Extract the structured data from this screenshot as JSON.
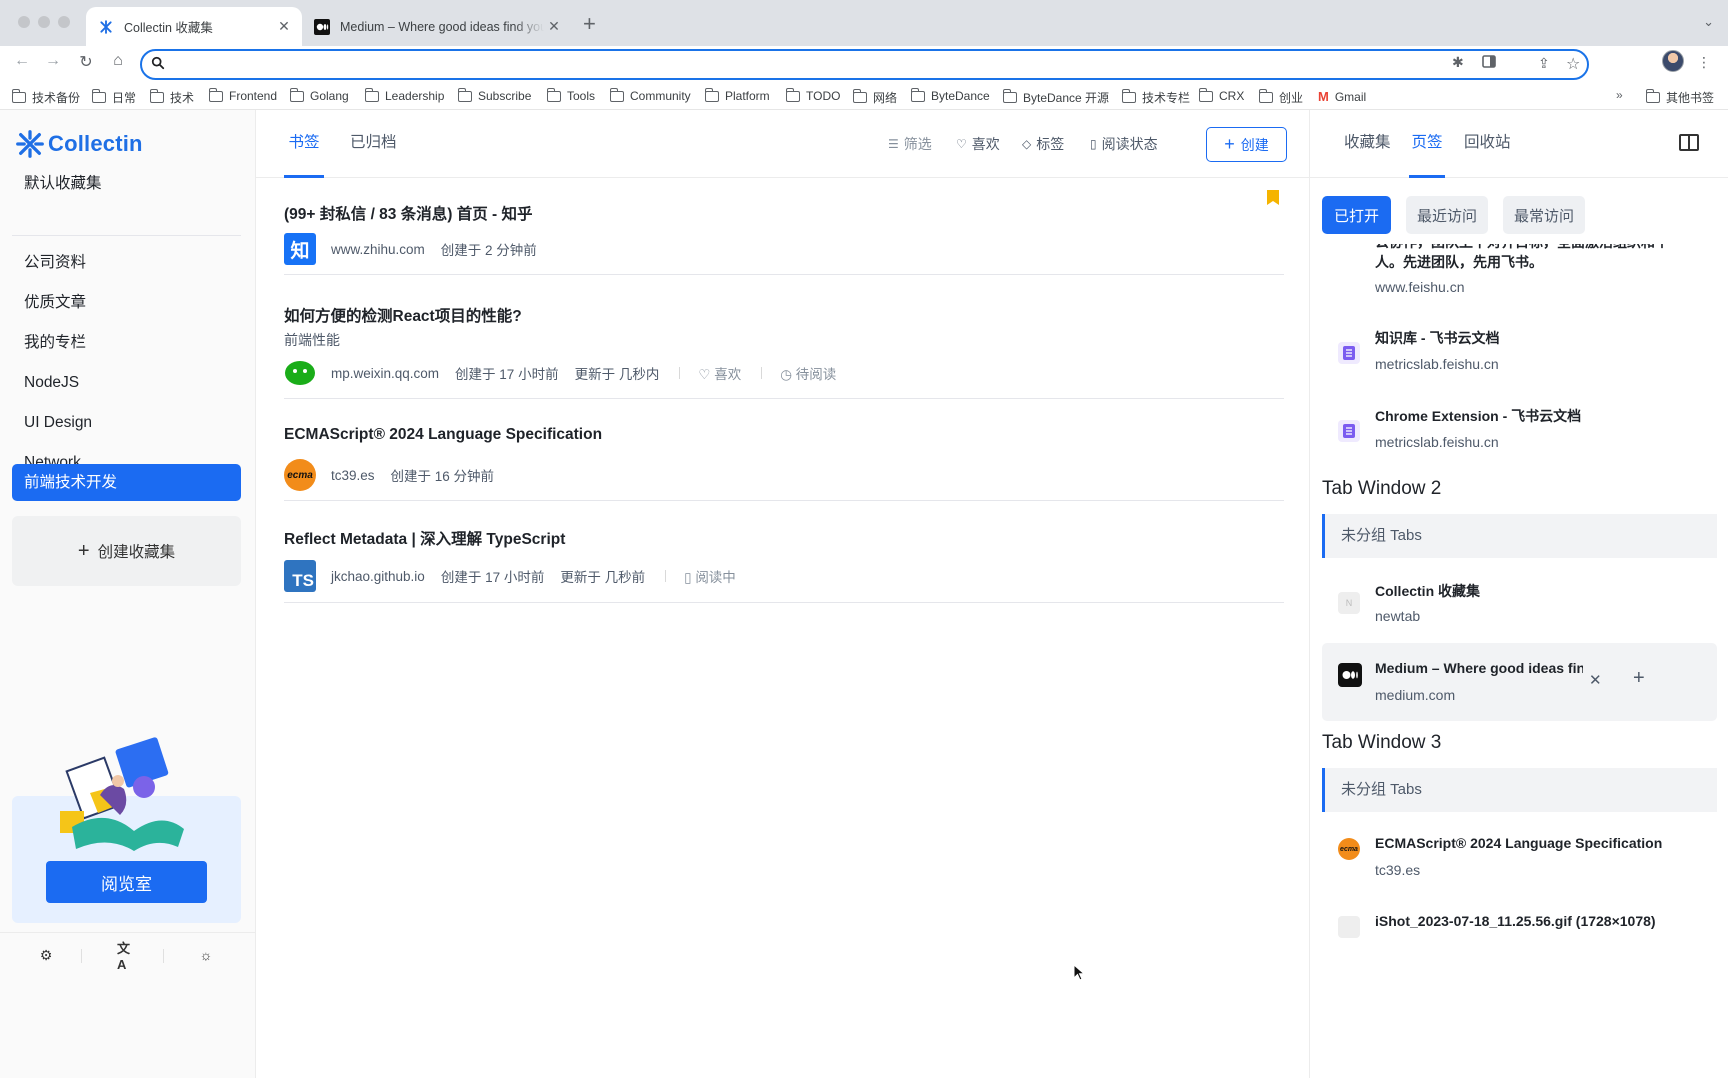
{
  "browser": {
    "tabs": [
      {
        "title": "Collectin 收藏集",
        "active": true,
        "icon": "collectin-logo-icon"
      },
      {
        "title": "Medium – Where good ideas find you",
        "active": false,
        "icon": "medium-logo-icon"
      }
    ],
    "address_value": "",
    "bookmarks": [
      "技术备份",
      "日常",
      "技术",
      "Frontend",
      "Golang",
      "Leadership",
      "Subscribe",
      "Tools",
      "Community",
      "Platform",
      "TODO",
      "网络",
      "ByteDance",
      "ByteDance 开源",
      "技术专栏",
      "CRX",
      "创业",
      "Gmail"
    ],
    "bookmarks_overflow": "»",
    "other_bookmarks": "其他书签"
  },
  "sidebar": {
    "brand": "Collectin",
    "default_collection": "默认收藏集",
    "collections": [
      "公司资料",
      "优质文章",
      "我的专栏",
      "NodeJS",
      "UI Design",
      "Network",
      "前端技术开发"
    ],
    "active_collection": "前端技术开发",
    "create_label": "创建收藏集",
    "reading_room_label": "阅览室"
  },
  "main": {
    "tabs": [
      "书签",
      "已归档"
    ],
    "active_tab": "书签",
    "filters": {
      "filter": "筛选",
      "like": "喜欢",
      "tags": "标签",
      "read_status": "阅读状态"
    },
    "create_label": "创建",
    "bookmarks": [
      {
        "title": "(99+ 封私信 / 83 条消息) 首页 - 知乎",
        "desc": "",
        "domain": "www.zhihu.com",
        "created": "创建于 2 分钟前",
        "updated": "",
        "like": "",
        "status": "",
        "favicon": "知",
        "favicon_color": "#1772f6",
        "flagged": true
      },
      {
        "title": "如何方便的检测React项目的性能?",
        "desc": "前端性能",
        "domain": "mp.weixin.qq.com",
        "created": "创建于 17 小时前",
        "updated": "更新于 几秒内",
        "like": "喜欢",
        "status": "待阅读",
        "favicon": "wechat",
        "favicon_color": "#1aad19",
        "flagged": false
      },
      {
        "title": "ECMAScript® 2024 Language Specification",
        "desc": "",
        "domain": "tc39.es",
        "created": "创建于 16 分钟前",
        "updated": "",
        "like": "",
        "status": "",
        "favicon": "ecma",
        "favicon_color": "#f28c1a",
        "flagged": false
      },
      {
        "title": "Reflect Metadata | 深入理解 TypeScript",
        "desc": "",
        "domain": "jkchao.github.io",
        "created": "创建于 17 小时前",
        "updated": "更新于 几秒前",
        "like": "",
        "status": "阅读中",
        "favicon": "TS",
        "favicon_color": "#2f74c0",
        "flagged": false
      }
    ]
  },
  "right_panel": {
    "tabs": [
      "收藏集",
      "页签",
      "回收站"
    ],
    "active_tab": "页签",
    "pills": [
      "已打开",
      "最近访问",
      "最常访问"
    ],
    "active_pill": "已打开",
    "partial_text_line1": "公协作，团队上下对齐目标，全面激活组织和个",
    "partial_text_line2": "人。先进团队，先用飞书。",
    "partial_url": "www.feishu.cn",
    "items_w1": [
      {
        "title": "知识库 - 飞书云文档",
        "url": "metricslab.feishu.cn"
      },
      {
        "title": "Chrome Extension - 飞书云文档",
        "url": "metricslab.feishu.cn"
      }
    ],
    "window2": {
      "title": "Tab Window 2",
      "group": "未分组 Tabs",
      "items": [
        {
          "title": "Collectin 收藏集",
          "url": "newtab"
        },
        {
          "title": "Medium – Where good ideas find you",
          "url": "medium.com"
        }
      ]
    },
    "window3": {
      "title": "Tab Window 3",
      "group": "未分组 Tabs",
      "items": [
        {
          "title": "ECMAScript® 2024 Language Specification",
          "url": "tc39.es"
        },
        {
          "title": "iShot_2023-07-18_11.25.56.gif (1728×1078)",
          "url": ""
        }
      ]
    }
  },
  "colors": {
    "primary": "#1b6bf2",
    "flag": "#f5b400",
    "feishu": "#7b5cf0"
  }
}
